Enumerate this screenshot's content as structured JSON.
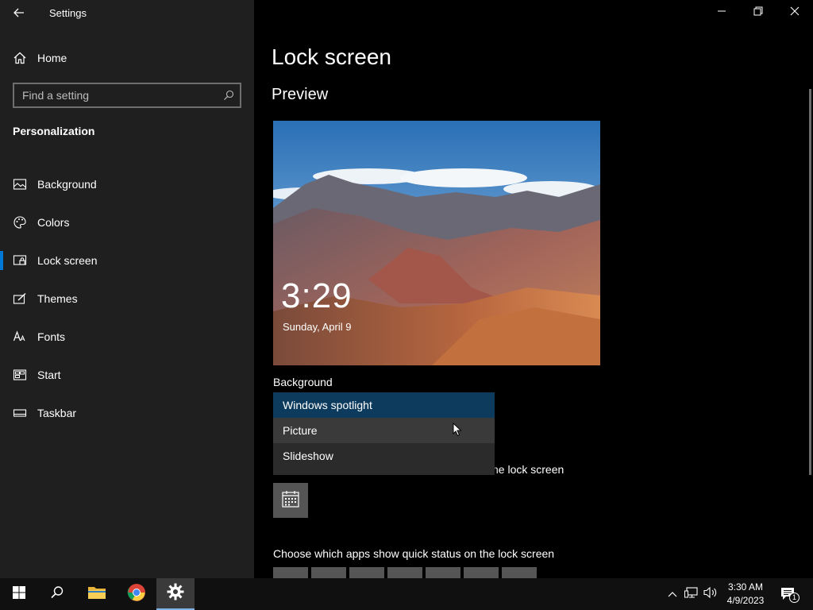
{
  "window": {
    "title": "Settings"
  },
  "sidebar": {
    "home_label": "Home",
    "search_placeholder": "Find a setting",
    "section_heading": "Personalization",
    "items": [
      {
        "label": "Background",
        "icon": "picture-icon",
        "active": false
      },
      {
        "label": "Colors",
        "icon": "palette-icon",
        "active": false
      },
      {
        "label": "Lock screen",
        "icon": "lock-screen-icon",
        "active": true
      },
      {
        "label": "Themes",
        "icon": "themes-icon",
        "active": false
      },
      {
        "label": "Fonts",
        "icon": "fonts-icon",
        "active": false
      },
      {
        "label": "Start",
        "icon": "start-icon",
        "active": false
      },
      {
        "label": "Taskbar",
        "icon": "taskbar-icon",
        "active": false
      }
    ]
  },
  "main": {
    "title": "Lock screen",
    "preview_heading": "Preview",
    "preview": {
      "time": "3:29",
      "date": "Sunday, April 9"
    },
    "background_label": "Background",
    "background_options": [
      {
        "label": "Windows spotlight",
        "state": "selected"
      },
      {
        "label": "Picture",
        "state": "hover"
      },
      {
        "label": "Slideshow",
        "state": "normal"
      }
    ],
    "partial_text": "ne lock screen",
    "quick_status_label": "Choose which apps show quick status on the lock screen"
  },
  "taskbar": {
    "clock_time": "3:30 AM",
    "clock_date": "4/9/2023",
    "notification_count": "1"
  },
  "colors": {
    "accent": "#0078d7",
    "sidebar_bg": "#1f1f1f",
    "dropdown_selected": "#0d3b5e"
  }
}
